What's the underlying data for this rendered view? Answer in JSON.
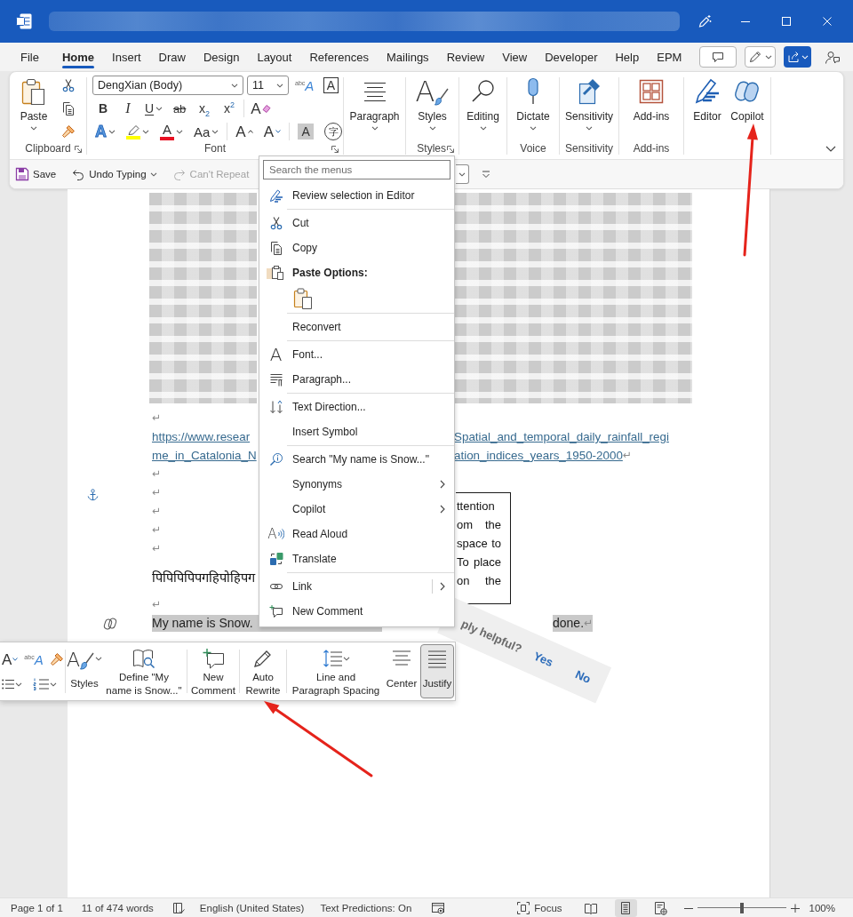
{
  "ribbon_tabs": [
    {
      "label": "File",
      "selected": false
    },
    {
      "label": "Home",
      "selected": true
    },
    {
      "label": "Insert",
      "selected": false
    },
    {
      "label": "Draw",
      "selected": false
    },
    {
      "label": "Design",
      "selected": false
    },
    {
      "label": "Layout",
      "selected": false
    },
    {
      "label": "References",
      "selected": false
    },
    {
      "label": "Mailings",
      "selected": false
    },
    {
      "label": "Review",
      "selected": false
    },
    {
      "label": "View",
      "selected": false
    },
    {
      "label": "Developer",
      "selected": false
    },
    {
      "label": "Help",
      "selected": false
    },
    {
      "label": "EPM",
      "selected": false
    }
  ],
  "ribbon": {
    "clipboard": {
      "label": "Clipboard",
      "launcher": true,
      "paste": {
        "label": "Paste",
        "dropdown": true
      }
    },
    "font": {
      "label": "Font",
      "launcher": true,
      "font_name": "DengXian (Body)",
      "font_size": "11",
      "row_1": [
        {
          "glyph": "$^{abc}$A",
          "dropdown": false
        },
        {
          "glyph": "A",
          "dropdown": false
        }
      ],
      "row_2": [
        {
          "glyph": "B",
          "dropdown": false
        },
        {
          "glyph": "I",
          "dropdown": false
        },
        {
          "glyph": "U",
          "dropdown": true
        },
        {
          "glyph": "ab",
          "dropdown": false
        },
        {
          "glyph": "x$_{2}$",
          "dropdown": false
        },
        {
          "glyph": "x$^{2}$",
          "dropdown": false
        },
        {
          "glyph": "A",
          "dropdown": false
        }
      ],
      "row_3": [
        {
          "glyph": "A",
          "dropdown": true
        },
        {
          "dropdown": true,
          "color": "#ffff00"
        },
        {
          "glyph": "A",
          "dropdown": true,
          "color": "#e81123"
        },
        {
          "glyph": "Aa",
          "dropdown": true
        },
        {
          "glyph": "A",
          "dropdown": false
        },
        {
          "glyph": "A",
          "dropdown": false
        },
        {
          "glyph": "A",
          "dropdown": false
        },
        {
          "glyph": "字",
          "dropdown": false
        }
      ]
    },
    "groups": [
      {
        "buttons": [
          {
            "label": "Paragraph",
            "dropdown": true
          }
        ]
      },
      {
        "label": "Styles",
        "launcher": true,
        "buttons": [
          {
            "label": "Styles",
            "glyph": "A",
            "dropdown": true
          }
        ]
      },
      {
        "buttons": [
          {
            "label": "Editing",
            "dropdown": true
          }
        ]
      },
      {
        "label": "Voice",
        "buttons": [
          {
            "label": "Dictate",
            "dropdown": true
          }
        ]
      },
      {
        "label": "Sensitivity",
        "buttons": [
          {
            "label": "Sensitivity",
            "dropdown": true
          }
        ]
      },
      {
        "label": "Add-ins",
        "buttons": [
          {
            "label": "Add-ins",
            "dropdown": false
          }
        ]
      },
      {
        "buttons": [
          {
            "label": "Editor",
            "dropdown": false
          },
          {
            "label": "Copilot",
            "dropdown": false
          }
        ]
      }
    ]
  },
  "quick_access": [
    {
      "label": "Save",
      "disabled": false,
      "dropdown": false
    },
    {
      "label": "Undo Typing",
      "disabled": false,
      "dropdown": true
    },
    {
      "label": "Can't Repeat",
      "disabled": true,
      "dropdown": false
    }
  ],
  "document": {
    "paragraphs": [
      {
        "kind": "mark",
        "text": "↵"
      },
      {
        "kind": "link",
        "lines": [
          {
            "left": "https://www.resear",
            "right": "Spatial_and_temporal_daily_rainfall_regi"
          },
          {
            "left": "me_in_Catalonia_N",
            "right": "ation_indices_years_1950-2000"
          }
        ],
        "mark": "↵"
      },
      {
        "kind": "mark",
        "text": "↵"
      },
      {
        "kind": "mark",
        "text": "↵"
      },
      {
        "kind": "mark",
        "text": "↵"
      },
      {
        "kind": "mark",
        "text": "↵"
      },
      {
        "kind": "mark",
        "text": "↵"
      },
      {
        "kind": "text",
        "text": "पिपिपिपिपगहिपोहिपग"
      },
      {
        "kind": "mark",
        "text": "↵"
      },
      {
        "kind": "selection",
        "left": "My name is Snow.",
        "right": "done.",
        "mark": "↵"
      }
    ],
    "text_box": {
      "lines": [
        "ttention",
        "om the",
        "space to",
        "To place",
        "on the"
      ]
    }
  },
  "feedback": {
    "question": "ply helpful?",
    "yes": "Yes",
    "no": "No"
  },
  "context_menu": {
    "search_placeholder": "Search the menus",
    "items": [
      {
        "kind": "item",
        "label": "Review selection in Editor",
        "submenu": false
      },
      {
        "kind": "separator"
      },
      {
        "kind": "item",
        "label": "Cut",
        "submenu": false
      },
      {
        "kind": "item",
        "label": "Copy",
        "submenu": false
      },
      {
        "kind": "heading",
        "label": "Paste Options:"
      },
      {
        "kind": "paste"
      },
      {
        "kind": "separator"
      },
      {
        "kind": "item",
        "label": "Reconvert",
        "submenu": false
      },
      {
        "kind": "separator"
      },
      {
        "kind": "item",
        "label": "Font...",
        "glyph": "A",
        "submenu": false
      },
      {
        "kind": "item",
        "label": "Paragraph...",
        "submenu": false
      },
      {
        "kind": "separator"
      },
      {
        "kind": "item",
        "label": "Text Direction...",
        "submenu": false
      },
      {
        "kind": "item",
        "label": "Insert Symbol",
        "submenu": false
      },
      {
        "kind": "separator"
      },
      {
        "kind": "item",
        "label": "Search \"My name is Snow...\"",
        "submenu": false
      },
      {
        "kind": "item",
        "label": "Synonyms",
        "submenu": true
      },
      {
        "kind": "item",
        "label": "Copilot",
        "submenu": true
      },
      {
        "kind": "item",
        "label": "Read Aloud",
        "glyph": "A",
        "submenu": false
      },
      {
        "kind": "item",
        "label": "Translate",
        "submenu": false
      },
      {
        "kind": "separator"
      },
      {
        "kind": "split",
        "label": "Link",
        "submenu": true
      },
      {
        "kind": "item",
        "label": "New Comment",
        "submenu": false
      }
    ]
  },
  "mini_toolbar": {
    "tools": [
      {
        "glyph": "A",
        "dropdown": false
      },
      {
        "glyph": "$^{abc}$A",
        "dropdown": false
      },
      {
        "dropdown": false
      },
      {
        "dropdown": true
      },
      {
        "dropdown": true
      }
    ],
    "buttons": [
      {
        "label": "Styles",
        "glyph": "A",
        "dropdown": true,
        "selected": false
      },
      {
        "label": "Define \"My\nname is Snow...\"",
        "dropdown": false,
        "selected": false
      },
      {
        "label": "New\nComment",
        "dropdown": false,
        "selected": false
      },
      {
        "label": "Auto\nRewrite",
        "dropdown": false,
        "selected": false
      },
      {
        "label": "Line and\nParagraph Spacing",
        "dropdown": true,
        "selected": false
      },
      {
        "label": "Center",
        "dropdown": false,
        "selected": false
      },
      {
        "label": "Justify",
        "dropdown": false,
        "selected": true
      }
    ]
  },
  "status_bar": {
    "page": "Page 1 of 1",
    "words": "11 of 474 words",
    "language": "English (United States)",
    "predictions": "Text Predictions: On",
    "focus": "Focus",
    "views": [
      {
        "selected": false
      },
      {
        "selected": true
      },
      {
        "selected": false
      }
    ],
    "zoom": {
      "level": 0.5,
      "reading": "100%"
    }
  }
}
